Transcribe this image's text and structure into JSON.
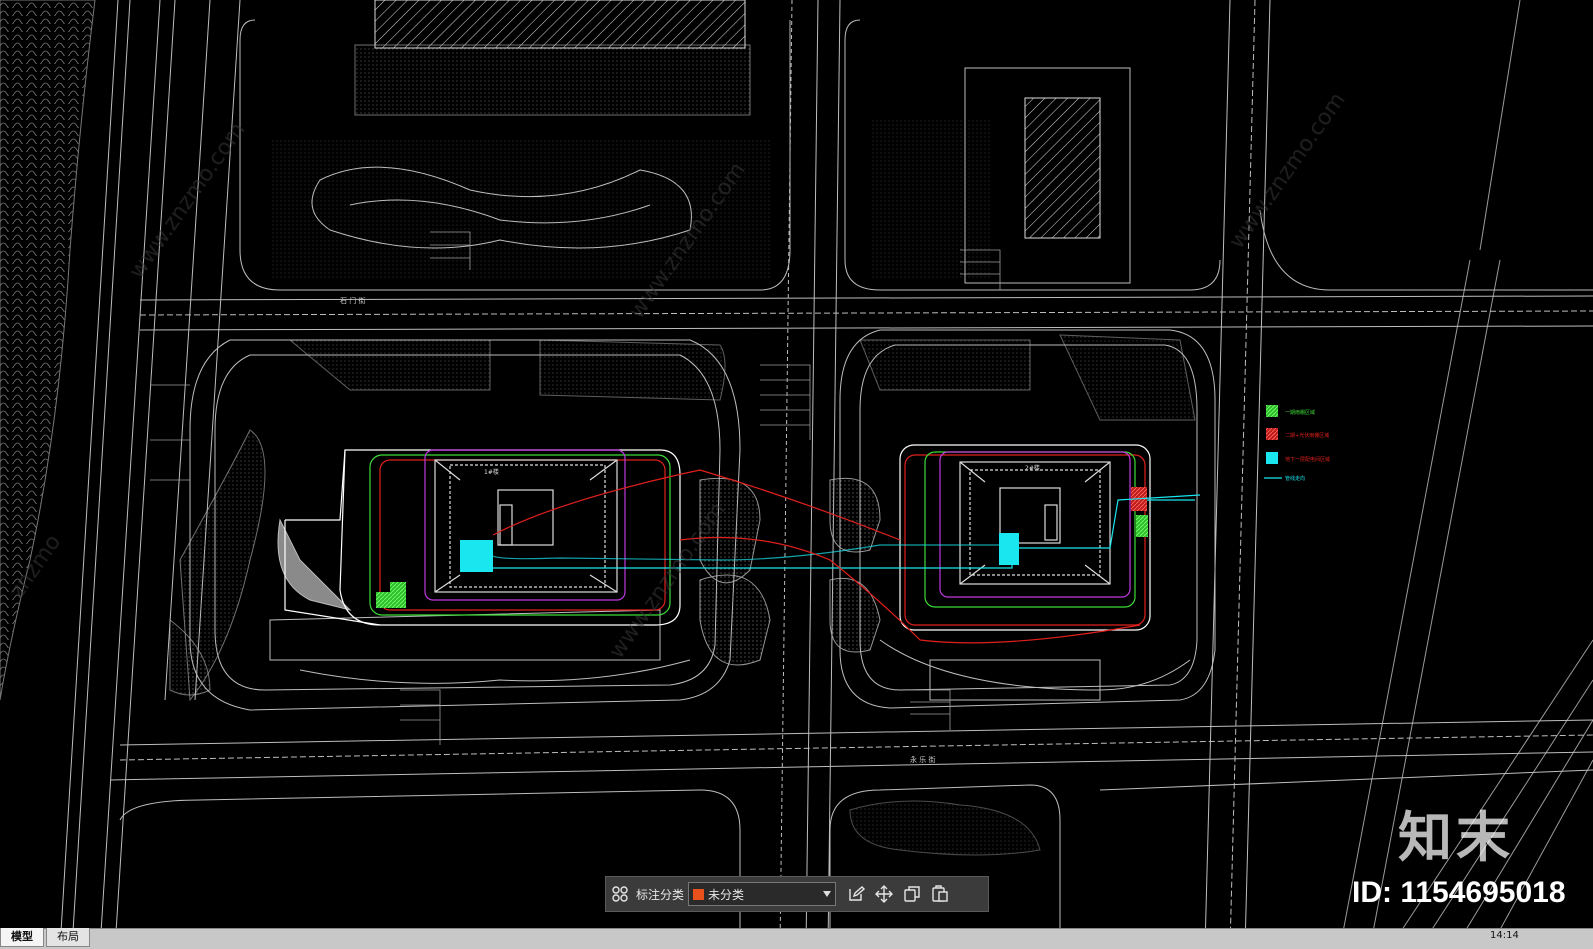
{
  "drawing": {
    "road_labels": [
      "石 门 街",
      "永 乐 街"
    ],
    "building_1_label": "1#楼",
    "building_2_label": "2#楼",
    "legend_items": [
      {
        "color": "#3ddc38",
        "text": "一期雨棚区域"
      },
      {
        "color": "#e0201c",
        "text": "二期+光伏雨棚区域"
      },
      {
        "color": "#19e6ee",
        "text": "地下一层配电间区域"
      },
      {
        "color": "#19e6ee",
        "text": "管线走向"
      }
    ],
    "colors": {
      "background": "#000000",
      "linework": "#bdbdbd",
      "green_fill": "#3ddc38",
      "cyan_fill": "#19e6ee",
      "red_fill": "#e0201c",
      "magenta_line": "#c03adf",
      "hatch": "#dcdcdc"
    }
  },
  "toolbar": {
    "label": "标注分类",
    "category_value": "未分类",
    "category_color": "#e8501c",
    "icons": [
      "grid-icon",
      "edit-icon",
      "move-icon",
      "copy-icon",
      "paste-icon"
    ]
  },
  "watermark": {
    "logo_text": "知末",
    "id_text": "ID: 1154695018"
  },
  "status_bar": {
    "tabs": [
      "模型",
      "布局"
    ],
    "clock": "14:14"
  }
}
